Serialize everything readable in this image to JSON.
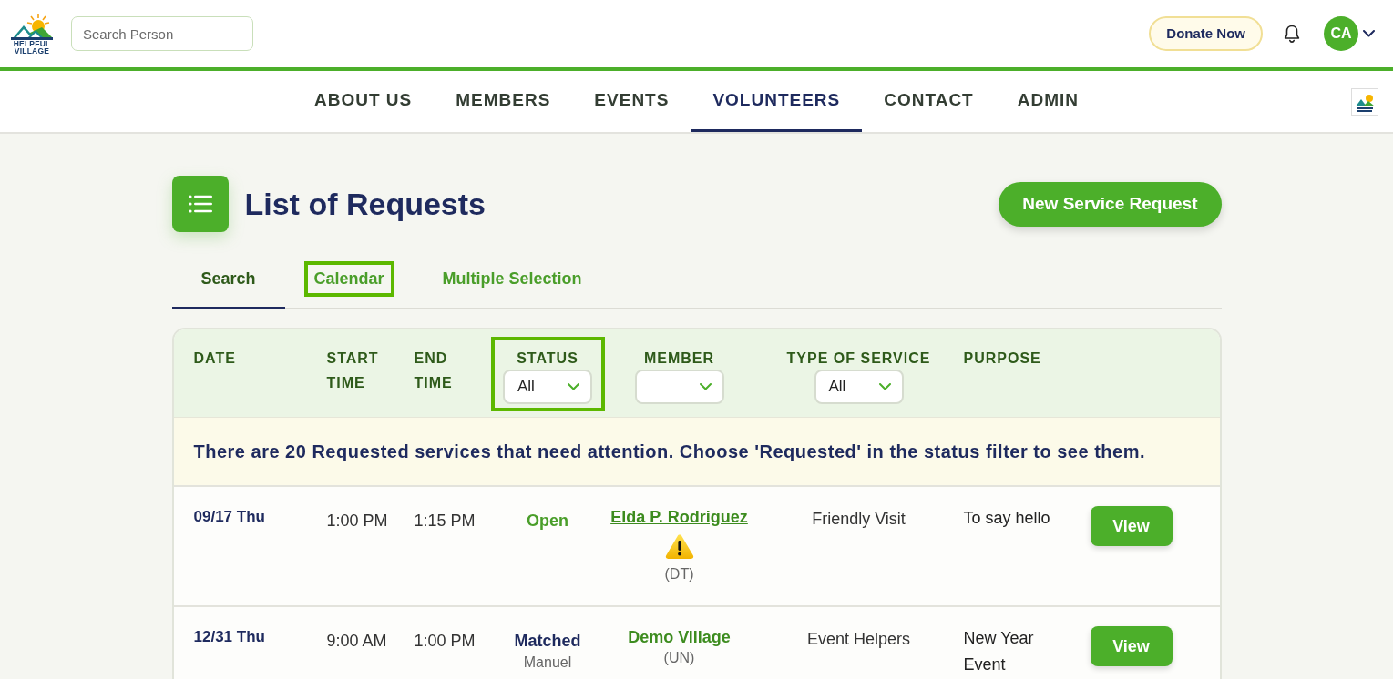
{
  "header": {
    "logo_text": "HELPFUL VILLAGE",
    "search": {
      "placeholder": "Search Person"
    },
    "donate_button": "Donate Now",
    "avatar": "CA"
  },
  "nav": [
    {
      "label": "ABOUT US",
      "selected": false
    },
    {
      "label": "MEMBERS",
      "selected": false
    },
    {
      "label": "EVENTS",
      "selected": false
    },
    {
      "label": "VOLUNTEERS",
      "selected": true
    },
    {
      "label": "CONTACT",
      "selected": false
    },
    {
      "label": "ADMIN",
      "selected": false
    }
  ],
  "page": {
    "title": "List of Requests",
    "new_request_button": "New Service Request"
  },
  "tabs": [
    {
      "label": "Search",
      "selected": true,
      "highlighted": false
    },
    {
      "label": "Calendar",
      "selected": false,
      "highlighted": true
    },
    {
      "label": "Multiple Selection",
      "selected": false,
      "highlighted": false
    }
  ],
  "table": {
    "columns": [
      {
        "label": "DATE",
        "kind": "text",
        "highlighted": false
      },
      {
        "label": "START TIME",
        "kind": "text",
        "highlighted": false
      },
      {
        "label": "END TIME",
        "kind": "text",
        "highlighted": false
      },
      {
        "label": "STATUS",
        "kind": "select",
        "value": "All",
        "highlighted": true
      },
      {
        "label": "MEMBER",
        "kind": "select",
        "highlighted": false
      },
      {
        "label": "TYPE OF SERVICE",
        "kind": "select",
        "value": "All",
        "highlighted": false
      },
      {
        "label": "PURPOSE",
        "kind": "text",
        "highlighted": false
      }
    ],
    "notice": "There are 20 Requested services that need attention. Choose 'Requested' in the status filter to see them.",
    "rows": [
      {
        "date": "09/17 Thu",
        "start_time": "1:00 PM",
        "end_time": "1:15 PM",
        "status": {
          "label": "Open",
          "kind": "open"
        },
        "member": {
          "name": "Elda P. Rodriguez",
          "warning": true,
          "code": "(DT)"
        },
        "type_of_service": "Friendly Visit",
        "purpose": "To say hello",
        "button": "View"
      },
      {
        "date": "12/31 Thu",
        "start_time": "9:00 AM",
        "end_time": "1:00 PM",
        "status": {
          "label": "Matched",
          "kind": "matched",
          "volunteer": "Manuel"
        },
        "member": {
          "name": "Demo Village",
          "warning": false,
          "code": "(UN)"
        },
        "type_of_service": "Event Helpers",
        "purpose": "New Year Event",
        "button": "View"
      }
    ]
  }
}
